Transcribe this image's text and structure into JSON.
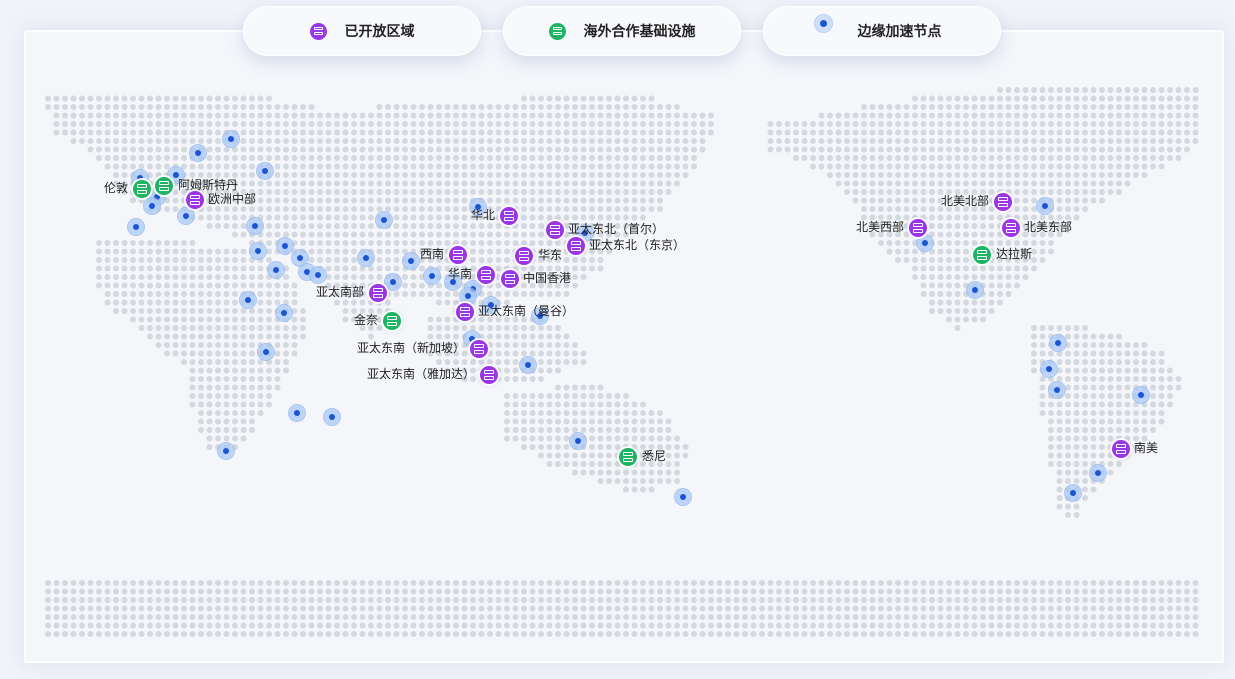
{
  "legend": {
    "open_regions": "已开放区域",
    "partner_infra": "海外合作基础设施",
    "edge_nodes": "边缘加速节点"
  },
  "regions": [
    {
      "label": "欧洲中部"
    },
    {
      "label": "华北"
    },
    {
      "label": "亚太东北（首尔）"
    },
    {
      "label": "亚太东北（东京）"
    },
    {
      "label": "华东"
    },
    {
      "label": "西南"
    },
    {
      "label": "华南"
    },
    {
      "label": "中国香港"
    },
    {
      "label": "亚太南部"
    },
    {
      "label": "亚太东南（曼谷）"
    },
    {
      "label": "亚太东南（新加坡）"
    },
    {
      "label": "亚太东南（雅加达）"
    },
    {
      "label": "北美北部"
    },
    {
      "label": "北美西部"
    },
    {
      "label": "北美东部"
    },
    {
      "label": "南美"
    }
  ],
  "partners": [
    {
      "label": "伦敦"
    },
    {
      "label": "阿姆斯特丹"
    },
    {
      "label": "金奈"
    },
    {
      "label": "悉尼"
    },
    {
      "label": "达拉斯"
    }
  ]
}
